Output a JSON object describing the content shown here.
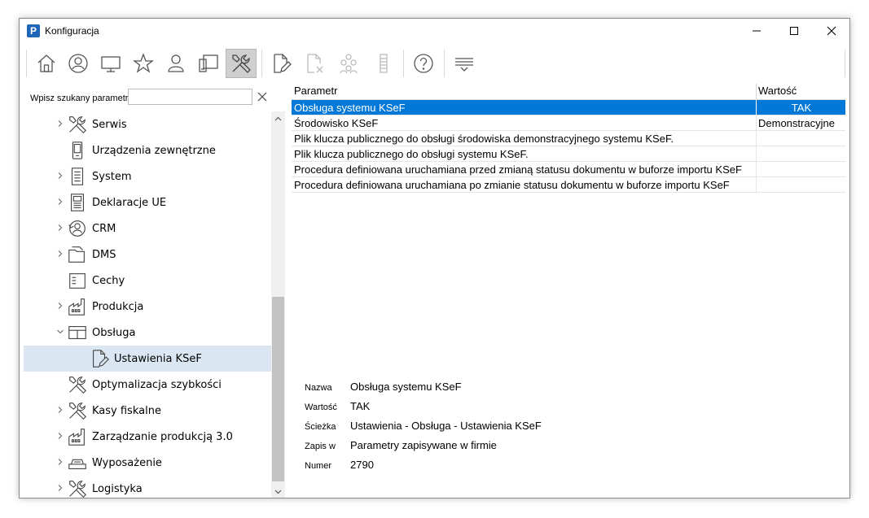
{
  "window": {
    "title": "Konfiguracja",
    "app_icon_letter": "P"
  },
  "titlebar_buttons": [
    {
      "name": "minimize-icon",
      "glyph": "—"
    },
    {
      "name": "maximize-icon",
      "glyph": "☐"
    },
    {
      "name": "close-icon",
      "glyph": "✕"
    }
  ],
  "toolbar": {
    "buttons": [
      {
        "name": "home-icon",
        "enabled": true
      },
      {
        "name": "user-circle-icon",
        "enabled": true
      },
      {
        "name": "monitor-icon",
        "enabled": true
      },
      {
        "name": "star-icon",
        "enabled": true
      },
      {
        "name": "person-icon",
        "enabled": true
      },
      {
        "name": "devices-icon",
        "enabled": true
      },
      {
        "name": "tools-icon",
        "enabled": true,
        "active": true
      },
      {
        "name": "edit-document-icon",
        "enabled": true
      },
      {
        "name": "delete-document-icon",
        "enabled": false
      },
      {
        "name": "group-icon",
        "enabled": false
      },
      {
        "name": "list-icon",
        "enabled": false
      },
      {
        "name": "help-icon",
        "enabled": true
      },
      {
        "name": "filter-icon",
        "enabled": true
      }
    ]
  },
  "search": {
    "label": "Wpisz szukany parametr",
    "value": ""
  },
  "tree": {
    "items": [
      {
        "label": "Serwis",
        "icon": "tools-icon",
        "expander": "collapsed",
        "level": 0
      },
      {
        "label": "Urządzenia zewnętrzne",
        "icon": "device-icon",
        "expander": "none",
        "level": 0
      },
      {
        "label": "System",
        "icon": "system-icon",
        "expander": "collapsed",
        "level": 0
      },
      {
        "label": "Deklaracje UE",
        "icon": "declaration-icon",
        "expander": "collapsed",
        "level": 0
      },
      {
        "label": "CRM",
        "icon": "crm-icon",
        "expander": "collapsed",
        "level": 0
      },
      {
        "label": "DMS",
        "icon": "folder-icon",
        "expander": "collapsed",
        "level": 0
      },
      {
        "label": "Cechy",
        "icon": "list-document-icon",
        "expander": "none",
        "level": 0
      },
      {
        "label": "Produkcja",
        "icon": "factory-icon",
        "expander": "collapsed",
        "level": 0
      },
      {
        "label": "Obsługa",
        "icon": "window-icon",
        "expander": "expanded",
        "level": 0
      },
      {
        "label": "Ustawienia KSeF",
        "icon": "edit-document-icon",
        "expander": "none",
        "level": 1,
        "selected": true
      },
      {
        "label": "Optymalizacja szybkości",
        "icon": "tools-icon",
        "expander": "none",
        "level": 0
      },
      {
        "label": "Kasy fiskalne",
        "icon": "tools-icon",
        "expander": "collapsed",
        "level": 0
      },
      {
        "label": "Zarządzanie produkcją 3.0",
        "icon": "factory-icon",
        "expander": "collapsed",
        "level": 0
      },
      {
        "label": "Wyposażenie",
        "icon": "equipment-icon",
        "expander": "collapsed",
        "level": 0
      },
      {
        "label": "Logistyka",
        "icon": "tools-icon",
        "expander": "collapsed",
        "level": 0
      }
    ]
  },
  "grid": {
    "columns": [
      "Parametr",
      "Wartość"
    ],
    "rows": [
      {
        "param": "Obsługa systemu KSeF",
        "value": "TAK",
        "align": "center",
        "selected": true
      },
      {
        "param": "Środowisko KSeF",
        "value": "Demonstracyjne",
        "align": "left"
      },
      {
        "param": "Plik klucza publicznego do obsługi środowiska demonstracyjnego systemu KSeF.",
        "value": "",
        "align": "left"
      },
      {
        "param": "Plik klucza publicznego do obsługi systemu KSeF.",
        "value": "",
        "align": "left"
      },
      {
        "param": "Procedura definiowana uruchamiana przed zmianą statusu dokumentu w buforze importu KSeF",
        "value": "",
        "align": "left"
      },
      {
        "param": "Procedura definiowana uruchamiana po zmianie statusu dokumentu w buforze importu KSeF",
        "value": "",
        "align": "left"
      }
    ]
  },
  "details": [
    {
      "label": "Nazwa",
      "value": "Obsługa systemu KSeF"
    },
    {
      "label": "Wartość",
      "value": "TAK"
    },
    {
      "label": "Ścieżka",
      "value": "Ustawienia - Obsługa - Ustawienia KSeF"
    },
    {
      "label": "Zapis w",
      "value": "Parametry zapisywane w firmie"
    },
    {
      "label": "Numer",
      "value": "2790"
    }
  ],
  "colors": {
    "selection": "#0078d7",
    "tree_selection": "#dae7f3",
    "brand": "#1e66b8"
  }
}
